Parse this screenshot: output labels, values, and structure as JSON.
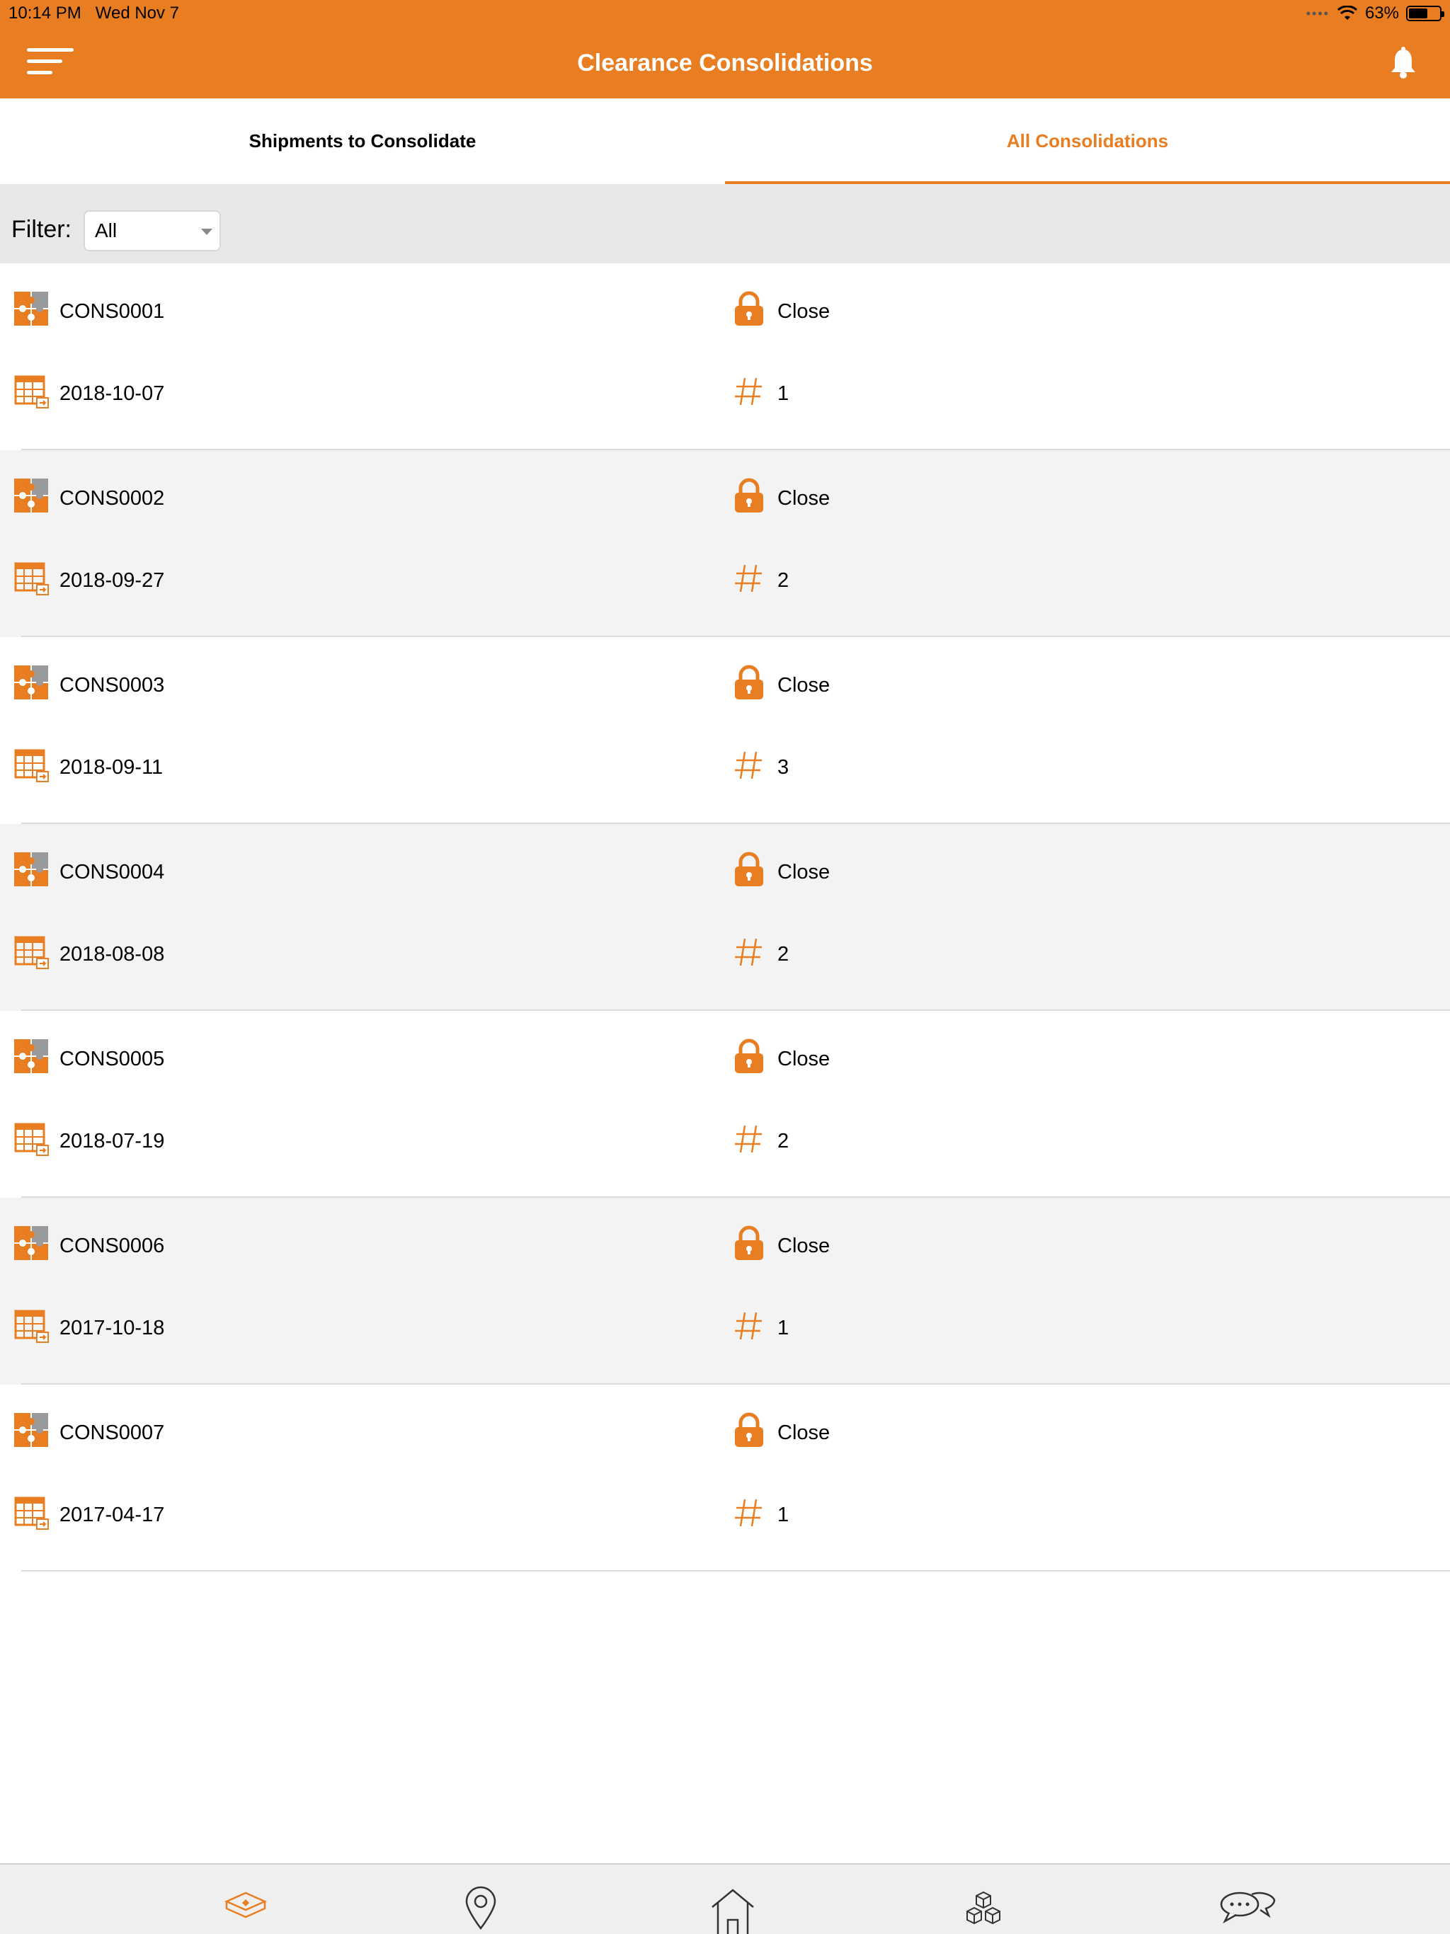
{
  "status_bar": {
    "time": "10:14 PM",
    "date": "Wed Nov 7",
    "battery": "63%",
    "battery_level": 0.63
  },
  "nav": {
    "title": "Clearance Consolidations"
  },
  "tabs": [
    {
      "label": "Shipments to Consolidate",
      "active": false
    },
    {
      "label": "All Consolidations",
      "active": true
    }
  ],
  "filter": {
    "label": "Filter:",
    "value": "All"
  },
  "consolidations": [
    {
      "id": "CONS0001",
      "status": "Close",
      "date": "2018-10-07",
      "count": "1"
    },
    {
      "id": "CONS0002",
      "status": "Close",
      "date": "2018-09-27",
      "count": "2"
    },
    {
      "id": "CONS0003",
      "status": "Close",
      "date": "2018-09-11",
      "count": "3"
    },
    {
      "id": "CONS0004",
      "status": "Close",
      "date": "2018-08-08",
      "count": "2"
    },
    {
      "id": "CONS0005",
      "status": "Close",
      "date": "2018-07-19",
      "count": "2"
    },
    {
      "id": "CONS0006",
      "status": "Close",
      "date": "2017-10-18",
      "count": "1"
    },
    {
      "id": "CONS0007",
      "status": "Close",
      "date": "2017-04-17",
      "count": "1"
    }
  ],
  "icons": {
    "menu": "hamburger-menu-icon",
    "notifications": "bell-icon",
    "consolidation": "puzzle-icon",
    "status": "lock-icon",
    "date": "calendar-icon",
    "count": "hash-icon",
    "bottom_nav": [
      "shipment-box-icon",
      "location-pin-icon",
      "home-icon",
      "packages-icon",
      "chat-icon"
    ]
  },
  "colors": {
    "accent": "#E97D21",
    "row_alt": "#F3F3F3",
    "filter_bg": "#E8E8E8"
  }
}
